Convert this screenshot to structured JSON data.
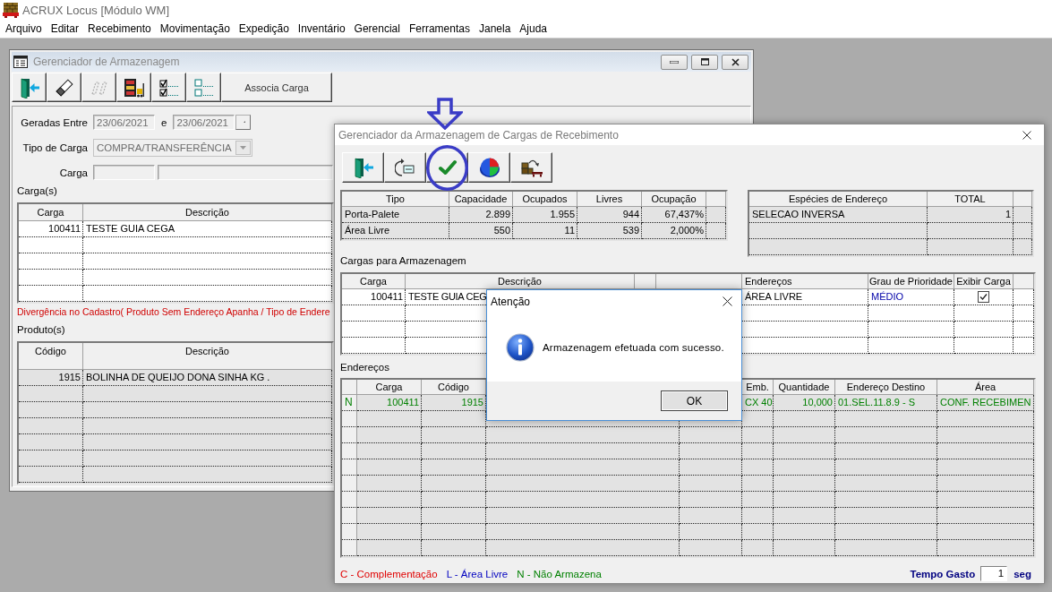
{
  "app": {
    "title": "ACRUX Locus [Módulo WM]"
  },
  "menu": [
    "Arquivo",
    "Editar",
    "Recebimento",
    "Movimentação",
    "Expedição",
    "Inventário",
    "Gerencial",
    "Ferramentas",
    "Janela",
    "Ajuda"
  ],
  "main_window": {
    "title": "Gerenciador de Armazenagem",
    "toolbar": [
      {
        "disabled": false
      },
      {
        "disabled": false
      },
      {
        "disabled": true
      },
      {
        "disabled": false
      },
      {
        "disabled": false
      },
      {
        "disabled": false
      },
      {
        "label": "Associa Carga",
        "disabled": false
      }
    ],
    "filters": {
      "geradas_entre": {
        "label": "Geradas Entre",
        "from": "23/06/2021",
        "connector": "e",
        "to": "23/06/2021",
        "disabled": true
      },
      "tipo_de_carga": {
        "label": "Tipo de Carga",
        "value": "COMPRA/TRANSFERÊNCIA",
        "disabled": true
      },
      "carga": {
        "label": "Carga",
        "disabled": true
      }
    },
    "cargas": {
      "label": "Carga(s)",
      "columns": [
        "Carga",
        "Descrição"
      ],
      "rows": [
        [
          "100411",
          "TESTE GUIA CEGA"
        ]
      ]
    },
    "warning": "Divergência no Cadastro( Produto Sem Endereço Apanha / Tipo de Endere",
    "produtos": {
      "label": "Produto(s)",
      "columns": [
        "Código",
        "Descrição"
      ],
      "rows": [
        [
          "1915",
          "BOLINHA DE QUEIJO DONA SINHA KG ."
        ]
      ]
    }
  },
  "receiving_window": {
    "title": "Gerenciador da Armazenagem de Cargas de Recebimento",
    "toolbar": [
      {
        "disabled": false
      },
      {
        "disabled": false
      },
      {
        "disabled": false
      },
      {
        "disabled": false
      },
      {
        "disabled": false
      }
    ],
    "capacity": {
      "columns": [
        "Tipo",
        "Capacidade",
        "Ocupados",
        "Livres",
        "Ocupação"
      ],
      "rows": [
        [
          "Porta-Palete",
          "2.899",
          "1.955",
          "944",
          "67,437%"
        ],
        [
          "Área Livre",
          "550",
          "11",
          "539",
          "2,000%"
        ]
      ]
    },
    "especies": {
      "columns": [
        "Espécies de Endereço",
        "TOTAL"
      ],
      "rows": [
        [
          "SELECAO INVERSA",
          "1"
        ]
      ]
    },
    "cargas": {
      "label": "Cargas para Armazenagem",
      "columns": {
        "carga": "Carga",
        "descricao": "Descrição",
        "enderecos": "Endereços",
        "grau_de_prioridade": "Grau de Prioridade",
        "exibir_carga": "Exibir Carga"
      },
      "rows": [
        {
          "carga": "100411",
          "descricao": "TESTE GUIA CEG",
          "enderecos": "ÁREA LIVRE",
          "grau_de_prioridade": "MÉDIO",
          "exibir_carga": true
        }
      ]
    },
    "enderecos": {
      "label": "Endereços",
      "columns": {
        "carga": "Carga",
        "codigo": "Código",
        "emb": "Emb.",
        "quantidade": "Quantidade",
        "endereco_destino": "Endereço Destino",
        "area": "Área"
      },
      "rows": [
        {
          "flag": "N",
          "color": "#008000",
          "carga": "100411",
          "codigo": "1915",
          "emb": "CX 40",
          "quantidade": "10,000",
          "endereco_destino": "01.SEL.11.8.9 - S",
          "area": "CONF. RECEBIMEN"
        }
      ]
    },
    "legend": [
      {
        "text": "C - Complementação",
        "color": "#e00000"
      },
      {
        "text": "L - Área Livre",
        "color": "#0000c0"
      },
      {
        "text": "N - Não Armazena",
        "color": "#008000"
      }
    ],
    "tempo_gasto": {
      "label": "Tempo Gasto",
      "value": "1",
      "unit": "seg"
    }
  },
  "dialog": {
    "title": "Atenção",
    "message": "Armazenagem efetuada com sucesso.",
    "buttons": [
      "OK"
    ]
  }
}
